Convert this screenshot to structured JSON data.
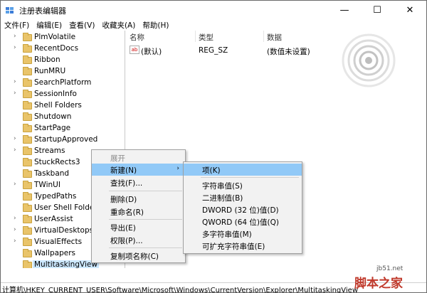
{
  "window": {
    "title": "注册表编辑器",
    "minimize_glyph": "—",
    "maximize_glyph": "☐",
    "close_glyph": "✕"
  },
  "menu": [
    "文件(F)",
    "编辑(E)",
    "查看(V)",
    "收藏夹(A)",
    "帮助(H)"
  ],
  "tree": {
    "items": [
      {
        "label": "PlmVolatile",
        "expandable": true
      },
      {
        "label": "RecentDocs",
        "expandable": true
      },
      {
        "label": "Ribbon",
        "expandable": false
      },
      {
        "label": "RunMRU",
        "expandable": false
      },
      {
        "label": "SearchPlatform",
        "expandable": true
      },
      {
        "label": "SessionInfo",
        "expandable": true
      },
      {
        "label": "Shell Folders",
        "expandable": false
      },
      {
        "label": "Shutdown",
        "expandable": false
      },
      {
        "label": "StartPage",
        "expandable": false
      },
      {
        "label": "StartupApproved",
        "expandable": true
      },
      {
        "label": "Streams",
        "expandable": true
      },
      {
        "label": "StuckRects3",
        "expandable": false
      },
      {
        "label": "Taskband",
        "expandable": false
      },
      {
        "label": "TWinUI",
        "expandable": true
      },
      {
        "label": "TypedPaths",
        "expandable": false
      },
      {
        "label": "User Shell Folders",
        "expandable": false
      },
      {
        "label": "UserAssist",
        "expandable": true
      },
      {
        "label": "VirtualDesktops",
        "expandable": true
      },
      {
        "label": "VisualEffects",
        "expandable": true
      },
      {
        "label": "Wallpapers",
        "expandable": false
      },
      {
        "label": "MultitaskingView",
        "expandable": false,
        "selected": true
      }
    ]
  },
  "list": {
    "headers": {
      "name": "名称",
      "type": "类型",
      "data": "数据"
    },
    "rows": [
      {
        "icon": "ab",
        "name": "(默认)",
        "type": "REG_SZ",
        "data": "(数值未设置)"
      }
    ]
  },
  "context_menu": {
    "items": [
      {
        "label": "展开",
        "disabled": true
      },
      {
        "label": "新建(N)",
        "submenu": true,
        "hover": true
      },
      {
        "label": "查找(F)..."
      },
      {
        "label": "删除(D)"
      },
      {
        "label": "重命名(R)"
      },
      {
        "label": "导出(E)"
      },
      {
        "label": "权限(P)..."
      },
      {
        "label": "复制项名称(C)"
      }
    ],
    "submenu_arrow": "›"
  },
  "submenu": {
    "items": [
      {
        "label": "项(K)",
        "hover": true
      },
      {
        "label": "字符串值(S)"
      },
      {
        "label": "二进制值(B)"
      },
      {
        "label": "DWORD (32 位)值(D)"
      },
      {
        "label": "QWORD (64 位)值(Q)"
      },
      {
        "label": "多字符串值(M)"
      },
      {
        "label": "可扩充字符串值(E)"
      }
    ]
  },
  "statusbar": {
    "path": "计算机\\HKEY_CURRENT_USER\\Software\\Microsoft\\Windows\\CurrentVersion\\Explorer\\MultitaskingView"
  },
  "watermark": {
    "site": "jb51.net",
    "name": "脚本之家"
  },
  "colors": {
    "selection": "#cce8ff",
    "menu_hover": "#91c9f7",
    "folder": "#e9c46a"
  }
}
